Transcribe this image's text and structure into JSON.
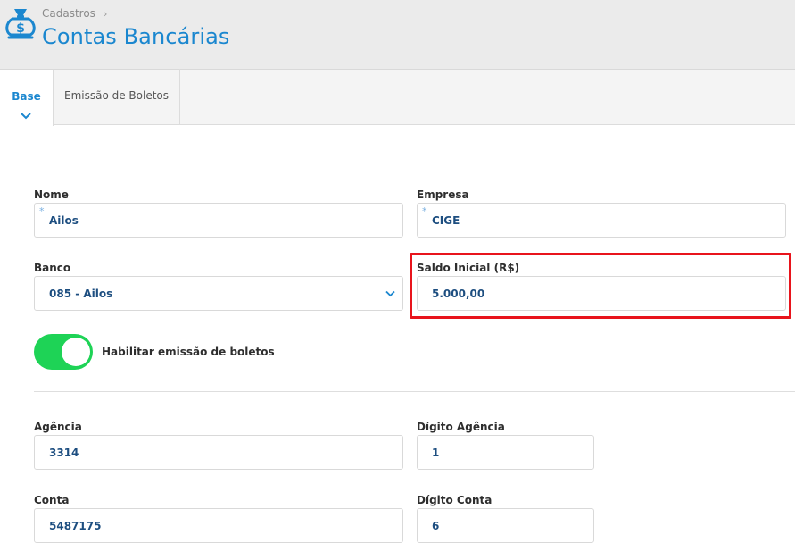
{
  "header": {
    "breadcrumb": "Cadastros",
    "title": "Contas Bancárias",
    "logo_icon": "money-bag-icon"
  },
  "tabs": [
    {
      "label": "Base",
      "active": true
    },
    {
      "label": "Emissão de Boletos",
      "active": false
    }
  ],
  "form": {
    "nome": {
      "label": "Nome",
      "value": "Ailos",
      "required": true
    },
    "empresa": {
      "label": "Empresa",
      "value": "CIGE",
      "required": true
    },
    "banco": {
      "label": "Banco",
      "value": "085 - Ailos"
    },
    "saldo": {
      "label": "Saldo Inicial (R$)",
      "value": "5.000,00"
    },
    "toggle": {
      "label": "Habilitar emissão de boletos",
      "on": true
    },
    "agencia": {
      "label": "Agência",
      "value": "3314"
    },
    "digito_agencia": {
      "label": "Dígito Agência",
      "value": "1"
    },
    "conta": {
      "label": "Conta",
      "value": "5487175"
    },
    "digito_conta": {
      "label": "Dígito Conta",
      "value": "6"
    }
  },
  "colors": {
    "accent": "#1b87cf",
    "toggle_on": "#1ed356",
    "highlight": "#e8141c",
    "input_text": "#1d4e80"
  }
}
